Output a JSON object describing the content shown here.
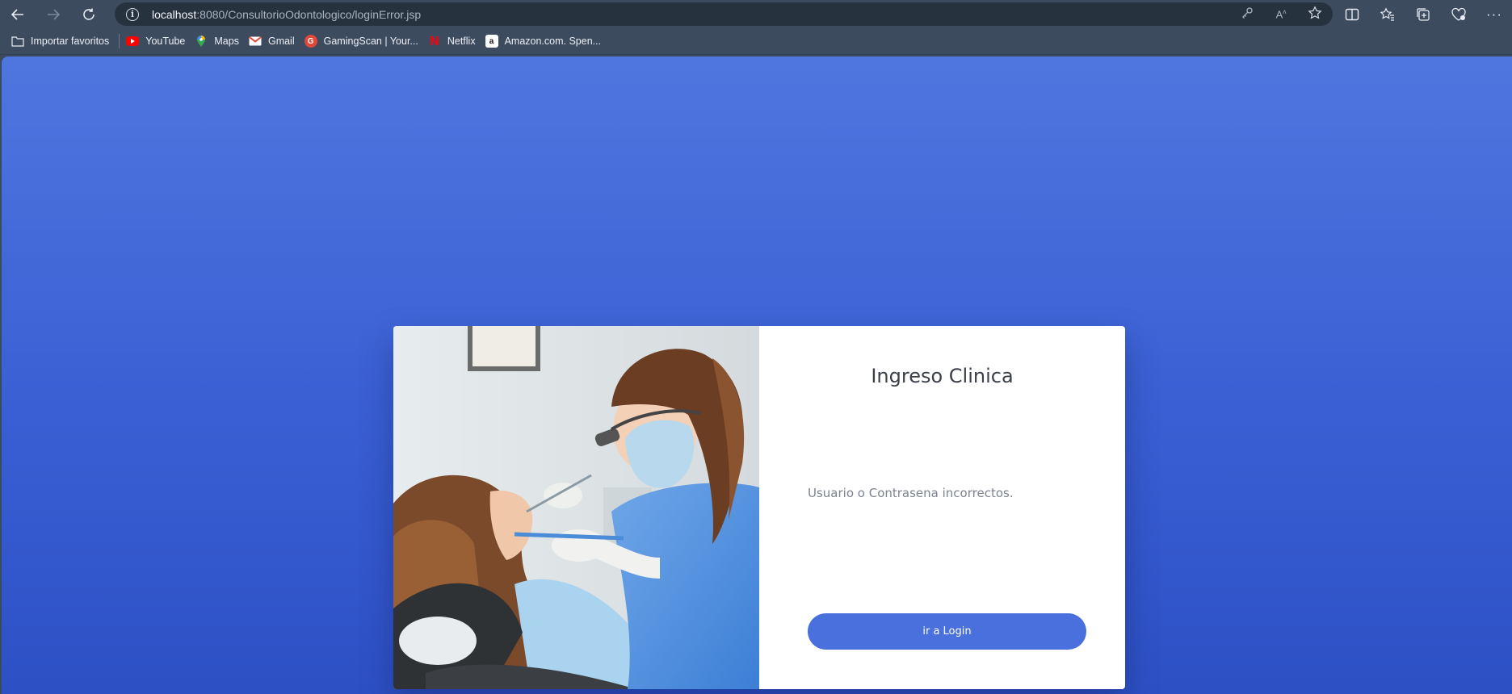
{
  "browser": {
    "url_host": "localhost",
    "url_rest": ":8080/ConsultorioOdontologico/loginError.jsp",
    "bookmarks": [
      {
        "label": "Importar favoritos",
        "icon": "folder-import-icon",
        "color": "#e8ecf1"
      },
      {
        "label": "YouTube",
        "icon": "youtube-icon",
        "color": "#ff0000"
      },
      {
        "label": "Maps",
        "icon": "maps-icon",
        "color": "#34a853"
      },
      {
        "label": "Gmail",
        "icon": "gmail-icon",
        "color": "#ea4335"
      },
      {
        "label": "GamingScan | Your...",
        "icon": "gamingscan-icon",
        "color": "#e0493a"
      },
      {
        "label": "Netflix",
        "icon": "netflix-icon",
        "color": "#e50914"
      },
      {
        "label": "Amazon.com. Spen...",
        "icon": "amazon-icon",
        "color": "#ffffff"
      }
    ]
  },
  "page": {
    "title": "Ingreso Clinica",
    "error_message": "Usuario o Contrasena incorrectos.",
    "login_button": "ir a Login",
    "colors": {
      "background_top": "#4f76df",
      "background_bottom": "#2d50c5",
      "button": "#4a70dd"
    }
  }
}
